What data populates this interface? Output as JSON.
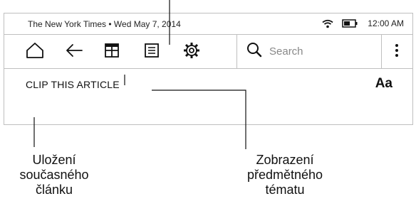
{
  "status_bar": {
    "left_text": "The New York Times • Wed May 7, 2014",
    "time": "12:00 AM"
  },
  "toolbar": {
    "icons": [
      "home-icon",
      "back-arrow-icon",
      "sections-grid-icon",
      "article-list-icon",
      "settings-gear-icon",
      "search-icon",
      "more-menu-icon"
    ],
    "search_placeholder": "Search"
  },
  "clip_row": {
    "clip_label": "CLIP THIS ARTICLE",
    "font_label": "Aa"
  },
  "captions": {
    "left": [
      "Uložení",
      "současného",
      "článku"
    ],
    "right": [
      "Zobrazení",
      "předmětného",
      "tématu"
    ]
  }
}
